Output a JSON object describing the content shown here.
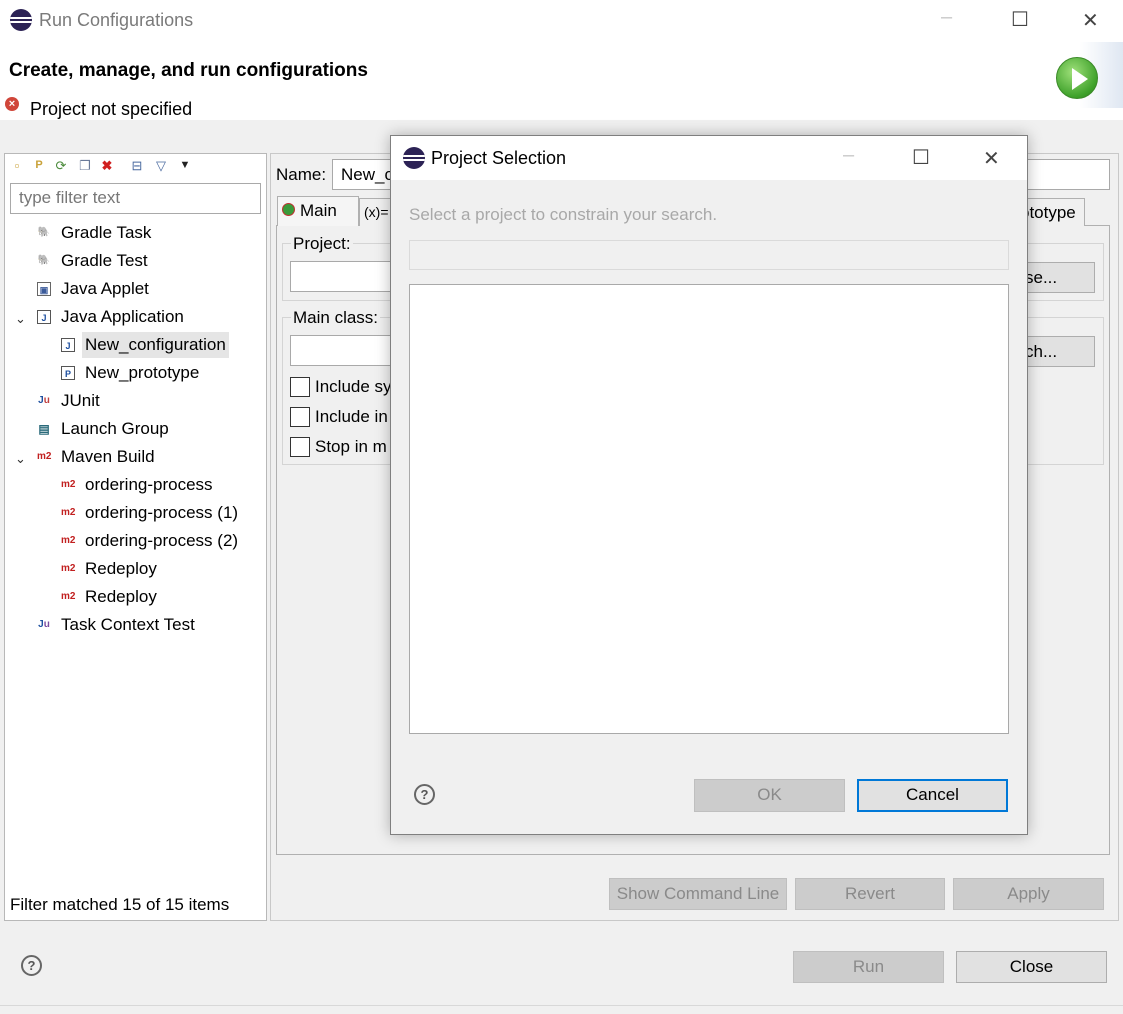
{
  "window": {
    "title": "Run Configurations",
    "minimize_glyph": "–",
    "maximize_glyph": "☐",
    "close_glyph": "✕"
  },
  "banner": {
    "heading": "Create, manage, and run configurations",
    "error_message": "Project not specified",
    "error_icon": "error-icon",
    "run_icon": "run-icon"
  },
  "left": {
    "toolbar_icons": [
      "new-launch-configuration-icon",
      "new-prototype-icon",
      "export-icon",
      "duplicate-icon",
      "delete-icon",
      "collapse-all-icon",
      "filter-icon",
      "view-menu-icon"
    ],
    "filter_placeholder": "type filter text",
    "tree": [
      {
        "label": "Gradle Task",
        "icon": "gradle-icon"
      },
      {
        "label": "Gradle Test",
        "icon": "gradle-icon"
      },
      {
        "label": "Java Applet",
        "icon": "applet-icon"
      },
      {
        "label": "Java Application",
        "icon": "java-app-icon",
        "expanded": true
      },
      {
        "label": "New_configuration",
        "icon": "java-app-icon",
        "selected": true
      },
      {
        "label": "New_prototype",
        "icon": "prototype-icon"
      },
      {
        "label": "JUnit",
        "icon": "junit-icon"
      },
      {
        "label": "Launch Group",
        "icon": "launch-group-icon"
      },
      {
        "label": "Maven Build",
        "icon": "maven-icon",
        "expanded": true
      },
      {
        "label": "ordering-process",
        "icon": "maven-icon"
      },
      {
        "label": "ordering-process (1)",
        "icon": "maven-icon"
      },
      {
        "label": "ordering-process (2)",
        "icon": "maven-icon"
      },
      {
        "label": "Redeploy",
        "icon": "maven-icon"
      },
      {
        "label": "Redeploy",
        "icon": "maven-icon"
      },
      {
        "label": "Task Context Test",
        "icon": "task-context-icon"
      }
    ],
    "filter_status": "Filter matched 15 of 15 items"
  },
  "right": {
    "name_label": "Name:",
    "name_value": "New_c",
    "tabs": [
      "Main",
      "(x)= A",
      "ototype"
    ],
    "project_label": "Project:",
    "browse_label": "se...",
    "main_class_label": "Main class:",
    "search_label": "ch...",
    "checkboxes": [
      "Include sy",
      "Include in",
      "Stop in m"
    ],
    "show_command_line": "Show Command Line",
    "revert": "Revert",
    "apply": "Apply"
  },
  "footer": {
    "run": "Run",
    "close": "Close",
    "help_glyph": "?"
  },
  "dialog": {
    "title": "Project Selection",
    "message": "Select a project to constrain your search.",
    "ok": "OK",
    "cancel": "Cancel",
    "help_glyph": "?",
    "minimize_glyph": "–",
    "maximize_glyph": "☐",
    "close_glyph": "✕"
  }
}
